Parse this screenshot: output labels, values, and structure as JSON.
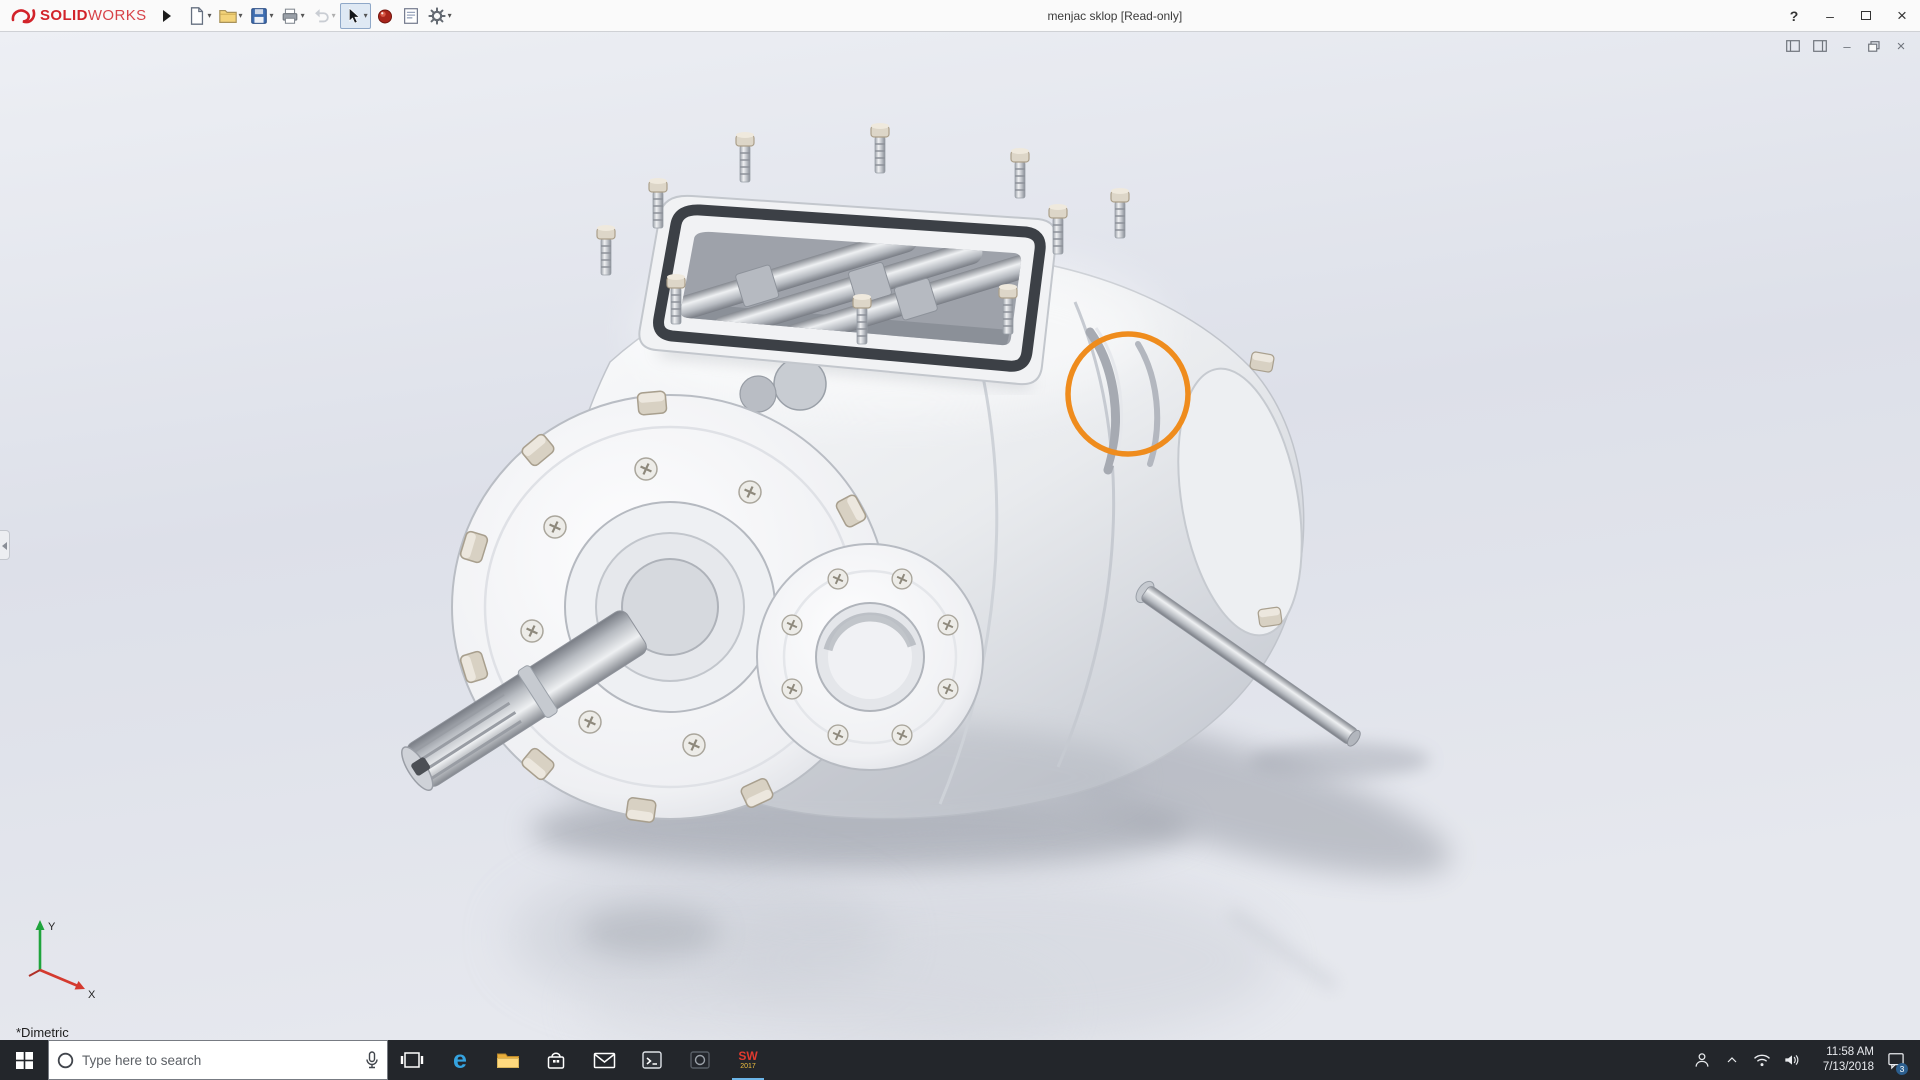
{
  "titlebar": {
    "brand": {
      "solid": "SOLID",
      "works": "WORKS"
    },
    "title": "menjac sklop [Read-only]",
    "controls": {
      "help": "?",
      "minimize": "–",
      "close": "×"
    }
  },
  "docwin": {
    "minimize": "–",
    "close": "×"
  },
  "viewport": {
    "view_orientation": "*Dimetric",
    "triad": {
      "x_label": "X",
      "y_label": "Y"
    },
    "annotation": {
      "shape": "circle",
      "color": "#ef8c1d"
    }
  },
  "taskbar": {
    "search": {
      "placeholder": "Type here to search"
    },
    "edge_glyph": "e",
    "solidworks": {
      "line1": "SW",
      "line2": "2017"
    },
    "tray": {
      "time": "11:58 AM",
      "date": "7/13/2018",
      "badge": "3"
    }
  },
  "icons": {
    "toolbar": [
      "new-document",
      "open",
      "save",
      "print",
      "undo",
      "select",
      "appearances",
      "sheet-format",
      "options"
    ],
    "taskbar": [
      "start",
      "cortana-ring",
      "microphone",
      "task-view",
      "edge",
      "file-explorer",
      "store",
      "mail",
      "console",
      "media-app",
      "solidworks"
    ],
    "tray": [
      "people",
      "chevron-up",
      "wifi",
      "volume",
      "action-center"
    ]
  }
}
